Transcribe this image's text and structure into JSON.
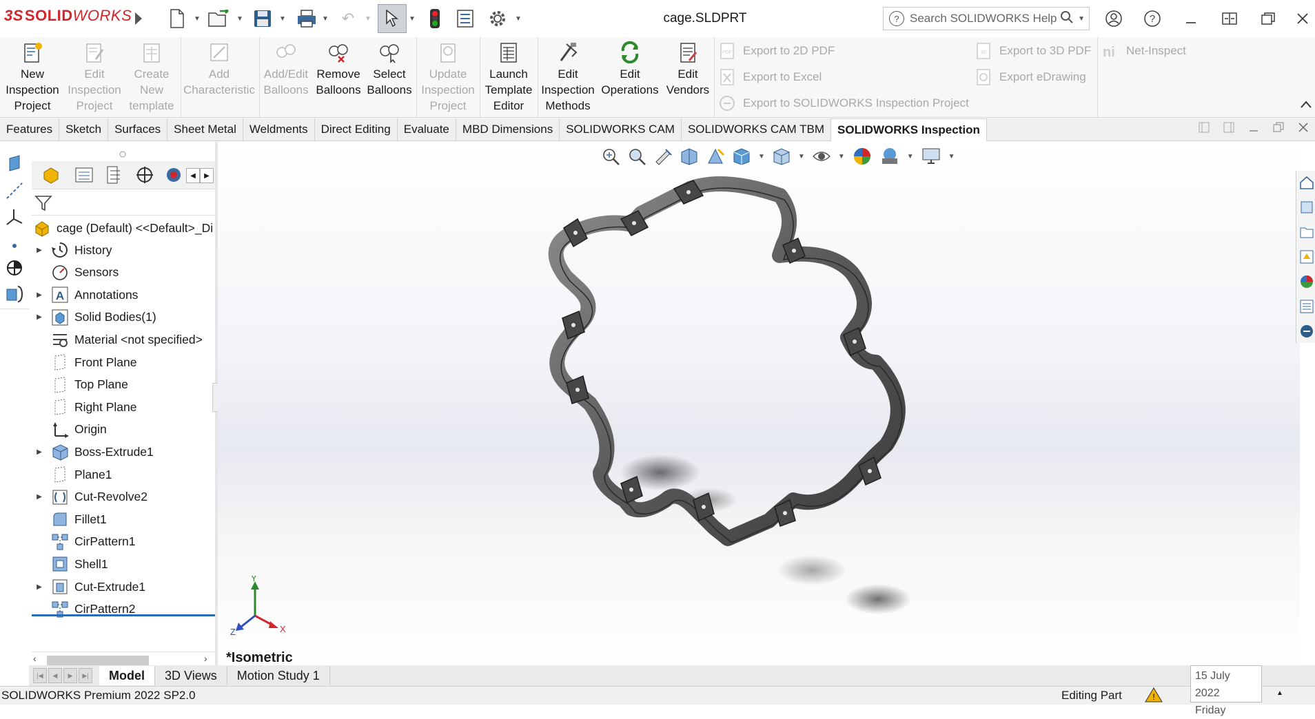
{
  "app": {
    "brand_prefix": "3S",
    "brand_solid": "SOLID",
    "brand_works": "WORKS",
    "document_title": "cage.SLDPRT",
    "help_search_placeholder": "Search SOLIDWORKS Help"
  },
  "ribbon": {
    "commands": [
      {
        "label": "New Inspection Project",
        "enabled": true
      },
      {
        "label": "Edit Inspection Project",
        "enabled": false
      },
      {
        "label": "Create New template",
        "enabled": false
      },
      {
        "label": "Add Characteristic",
        "enabled": false
      },
      {
        "label": "Add/Edit Balloons",
        "enabled": false
      },
      {
        "label": "Remove Balloons",
        "enabled": true
      },
      {
        "label": "Select Balloons",
        "enabled": true
      },
      {
        "label": "Update Inspection Project",
        "enabled": false
      },
      {
        "label": "Launch Template Editor",
        "enabled": true
      },
      {
        "label": "Edit Inspection Methods",
        "enabled": true
      },
      {
        "label": "Edit Operations",
        "enabled": true
      },
      {
        "label": "Edit Vendors",
        "enabled": true
      }
    ],
    "exports": {
      "pdf2d": "Export to 2D PDF",
      "excel": "Export to Excel",
      "inspection_project": "Export to SOLIDWORKS Inspection Project",
      "pdf3d": "Export to 3D PDF",
      "edrawing": "Export eDrawing",
      "net_inspect": "Net-Inspect"
    }
  },
  "tabs": [
    "Features",
    "Sketch",
    "Surfaces",
    "Sheet Metal",
    "Weldments",
    "Direct Editing",
    "Evaluate",
    "MBD Dimensions",
    "SOLIDWORKS CAM",
    "SOLIDWORKS CAM TBM",
    "SOLIDWORKS Inspection"
  ],
  "active_tab": "SOLIDWORKS Inspection",
  "feature_tree": {
    "root": "cage (Default) <<Default>_Di",
    "items": [
      {
        "label": "History",
        "expandable": true,
        "icon": "history-icon"
      },
      {
        "label": "Sensors",
        "expandable": false,
        "icon": "sensor-icon"
      },
      {
        "label": "Annotations",
        "expandable": true,
        "icon": "annotation-icon"
      },
      {
        "label": "Solid Bodies(1)",
        "expandable": true,
        "icon": "solid-bodies-icon"
      },
      {
        "label": "Material <not specified>",
        "expandable": false,
        "icon": "material-icon"
      },
      {
        "label": "Front Plane",
        "expandable": false,
        "icon": "plane-icon"
      },
      {
        "label": "Top Plane",
        "expandable": false,
        "icon": "plane-icon"
      },
      {
        "label": "Right Plane",
        "expandable": false,
        "icon": "plane-icon"
      },
      {
        "label": "Origin",
        "expandable": false,
        "icon": "origin-icon"
      },
      {
        "label": "Boss-Extrude1",
        "expandable": true,
        "icon": "extrude-icon"
      },
      {
        "label": "Plane1",
        "expandable": false,
        "icon": "plane-icon"
      },
      {
        "label": "Cut-Revolve2",
        "expandable": true,
        "icon": "revolve-icon"
      },
      {
        "label": "Fillet1",
        "expandable": false,
        "icon": "fillet-icon"
      },
      {
        "label": "CirPattern1",
        "expandable": false,
        "icon": "pattern-icon"
      },
      {
        "label": "Shell1",
        "expandable": false,
        "icon": "shell-icon"
      },
      {
        "label": "Cut-Extrude1",
        "expandable": true,
        "icon": "cut-extrude-icon"
      },
      {
        "label": "CirPattern2",
        "expandable": false,
        "icon": "pattern-icon"
      }
    ]
  },
  "viewport": {
    "view_label": "*Isometric",
    "triad": {
      "x": "X",
      "y": "Y",
      "z": "Z"
    }
  },
  "bottom_tabs": [
    "Model",
    "3D Views",
    "Motion Study 1"
  ],
  "active_bottom_tab": "Model",
  "status": {
    "product": "SOLIDWORKS Premium 2022 SP2.0",
    "mode": "Editing Part",
    "date": "15 July 2022",
    "day": "Friday"
  },
  "colors": {
    "brand_red": "#d0262c",
    "ribbon_bg": "#f7f7f7",
    "active_tab_bg": "#ffffff",
    "part_metal": "#6e6e6e"
  }
}
